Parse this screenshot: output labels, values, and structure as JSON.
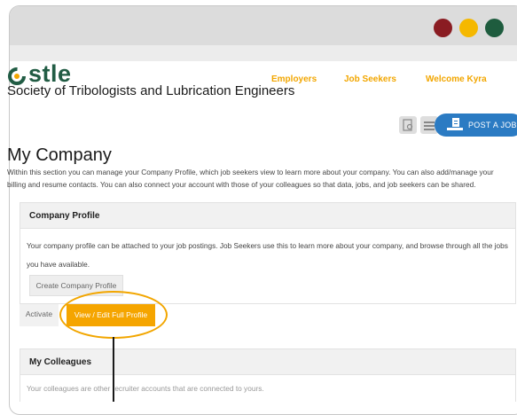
{
  "window": {
    "dots": [
      {
        "name": "red",
        "color": "#8a1c22"
      },
      {
        "name": "yellow",
        "color": "#f5b800"
      },
      {
        "name": "green",
        "color": "#1e5c3e"
      }
    ]
  },
  "brand": {
    "logo_text": "stle",
    "org_name": "Society of Tribologists and Lubrication Engineers",
    "color": "#215c44",
    "accent": "#f2a600"
  },
  "nav": {
    "employers": "Employers",
    "job_seekers": "Job Seekers",
    "welcome": "Welcome Kyra"
  },
  "toolbar": {
    "post_job_label": "POST A JOB"
  },
  "page": {
    "title": "My Company",
    "intro": "Within this section you can manage your Company Profile, which job seekers view to learn more about your company. You can also add/manage your billing and resume contacts. You can also connect your account with those of your colleagues so that data, jobs, and job seekers can be shared."
  },
  "company_profile": {
    "heading": "Company Profile",
    "description": "Your company profile can be attached to your job postings. Job Seekers use this to learn more about your company, and browse through all the jobs you have available.",
    "create_button": "Create Company Profile",
    "activate_label": "Activate",
    "view_edit_button": "View / Edit Full Profile"
  },
  "colleagues": {
    "heading": "My Colleagues",
    "description": "Your colleagues are other recruiter accounts that are connected to yours."
  }
}
